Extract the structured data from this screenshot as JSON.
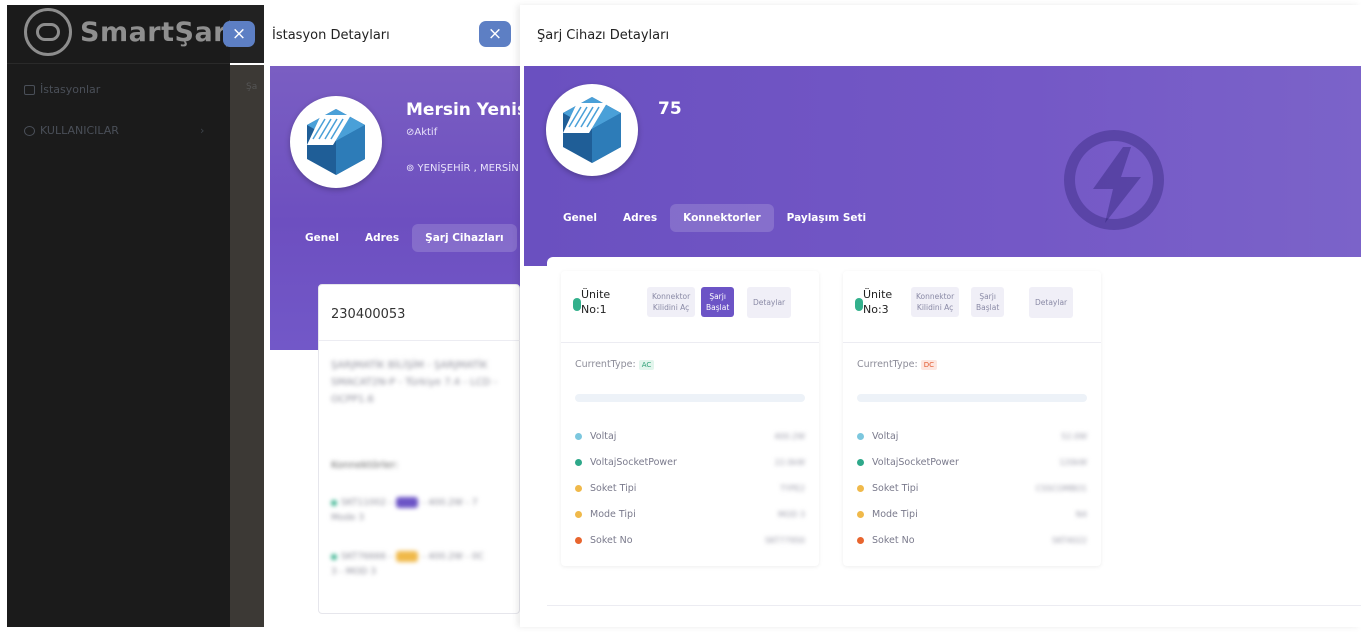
{
  "app": {
    "logo_text": "SmartŞarj",
    "sidebar": [
      {
        "label": "İstasyonlar"
      },
      {
        "label": "KULLANICILAR"
      }
    ],
    "main_fragment": "Şa"
  },
  "panel_station": {
    "title": "İstasyon Detayları",
    "close_label": "×",
    "name": "Mersin Yenişehir",
    "status": "⊘Aktif",
    "address": "⊚ YENİŞEHİR , MERSİN",
    "tabs": [
      "Genel",
      "Adres",
      "Şarj Cihazları"
    ],
    "device_number": "230400053",
    "device_description": "ŞARJMATİK BİLİŞİM - ŞARJMATİK SMACAT2N-P - Türkiye 7.4 - LCD - OCPP1.6",
    "connectors_heading": "Konnektörler:",
    "connector_rows": [
      {
        "text_a": "SKT11002 -",
        "badge": "AC",
        "text_b": "- 400.2W - 7",
        "text_c": "Mode 3",
        "color": "#33b08c",
        "badge_color": "#6c54c6"
      },
      {
        "text_a": "SKT76666 -",
        "badge": "DC",
        "text_b": "- 400.2W - 0C",
        "text_c": "3 - MOD 3",
        "color": "#33b08c",
        "badge_color": "#f0b94a"
      }
    ]
  },
  "panel_charger": {
    "title": "Şarj Cihazı Detayları",
    "close_label": "×",
    "charger_id": "75",
    "tabs": [
      "Genel",
      "Adres",
      "Konnektorler",
      "Paylaşım Seti"
    ],
    "active_tab": "Konnektorler",
    "connectors": [
      {
        "unit_label_1": "Ünite",
        "unit_label_2": "No:1",
        "btn_unlock_1": "Konnektor",
        "btn_unlock_2": "Kilidini Aç",
        "btn_start_1": "Şarjı",
        "btn_start_2": "Başlat",
        "btn_details": "Detaylar",
        "current_type_label": "CurrentType:",
        "current_type": "AC",
        "stats": [
          {
            "label": "Voltaj",
            "value": "400.2W",
            "color": "#7cc7de"
          },
          {
            "label": "VoltajSocketPower",
            "value": "22.0kW",
            "color": "#2ea88a"
          },
          {
            "label": "Soket Tipi",
            "value": "TYPE2",
            "color": "#f0b94a"
          },
          {
            "label": "Mode Tipi",
            "value": "MOD 3",
            "color": "#f0b94a"
          },
          {
            "label": "Soket No",
            "value": "SKT77950",
            "color": "#e8652e"
          }
        ]
      },
      {
        "unit_label_1": "Ünite",
        "unit_label_2": "No:3",
        "btn_unlock_1": "Konnektor",
        "btn_unlock_2": "Kilidini Aç",
        "btn_start_1": "Şarjı",
        "btn_start_2": "Başlat",
        "btn_details": "Detaylar",
        "current_type_label": "CurrentType:",
        "current_type": "DC",
        "stats": [
          {
            "label": "Voltaj",
            "value": "52.0W",
            "color": "#7cc7de"
          },
          {
            "label": "VoltajSocketPower",
            "value": "120kW",
            "color": "#2ea88a"
          },
          {
            "label": "Soket Tipi",
            "value": "CSSCOMBO1",
            "color": "#f0b94a"
          },
          {
            "label": "Mode Tipi",
            "value": "N4",
            "color": "#f0b94a"
          },
          {
            "label": "Soket No",
            "value": "SKT4022",
            "color": "#e8652e"
          }
        ]
      }
    ]
  }
}
